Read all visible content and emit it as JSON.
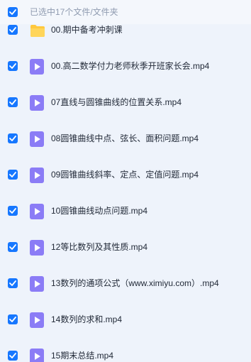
{
  "header": {
    "title": "已选中17个文件/文件夹"
  },
  "files": [
    {
      "name": "00.期中备考冲刺课",
      "type": "folder",
      "icon": "folder-icon"
    },
    {
      "name": "00.高二数学付力老师秋季开班家长会.mp4",
      "type": "video",
      "icon": "video-file-icon"
    },
    {
      "name": "07直线与圆锥曲线的位置关系.mp4",
      "type": "video",
      "icon": "video-file-icon"
    },
    {
      "name": "08圆锥曲线中点、弦长、面积问题.mp4",
      "type": "video",
      "icon": "video-file-icon"
    },
    {
      "name": "09圆锥曲线斜率、定点、定值问题.mp4",
      "type": "video",
      "icon": "video-file-icon"
    },
    {
      "name": "10圆锥曲线动点问题.mp4",
      "type": "video",
      "icon": "video-file-icon"
    },
    {
      "name": "12等比数列及其性质.mp4",
      "type": "video",
      "icon": "video-file-icon"
    },
    {
      "name": "13数列的通项公式（www.ximiyu.com）.mp4",
      "type": "video",
      "icon": "video-file-icon"
    },
    {
      "name": "14数列的求和.mp4",
      "type": "video",
      "icon": "video-file-icon"
    },
    {
      "name": "15期末总结.mp4",
      "type": "video",
      "icon": "video-file-icon"
    }
  ],
  "colors": {
    "accent": "#1677ff",
    "video_icon": "#8b7cf6",
    "folder_icon": "#ffc83d"
  }
}
